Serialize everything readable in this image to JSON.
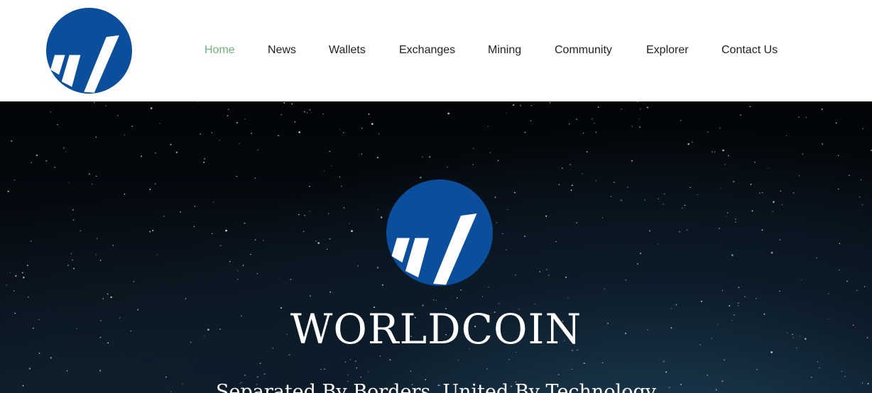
{
  "brand": {
    "logo_icon": "worldcoin-logo-icon",
    "logo_color": "#0b4f9c"
  },
  "nav": {
    "active_color": "#6fb57c",
    "items": [
      {
        "label": "Home",
        "active": true
      },
      {
        "label": "News"
      },
      {
        "label": "Wallets"
      },
      {
        "label": "Exchanges"
      },
      {
        "label": "Mining"
      },
      {
        "label": "Community"
      },
      {
        "label": "Explorer"
      },
      {
        "label": "Contact Us"
      }
    ]
  },
  "hero": {
    "title": "WORLDCOIN",
    "subtitle": "Separated By Borders, United By Technology"
  }
}
